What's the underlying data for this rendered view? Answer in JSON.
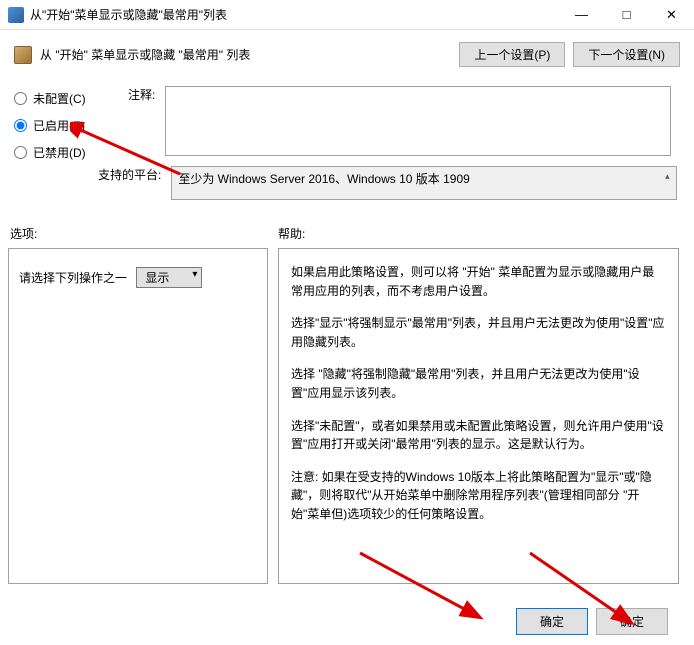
{
  "window": {
    "title": "从\"开始\"菜单显示或隐藏\"最常用\"列表"
  },
  "header": {
    "title": "从 \"开始\" 菜单显示或隐藏 \"最常用\" 列表",
    "prev_btn": "上一个设置(P)",
    "next_btn": "下一个设置(N)"
  },
  "radios": {
    "not_configured": "未配置(C)",
    "enabled": "已启用(E)",
    "disabled": "已禁用(D)"
  },
  "comment": {
    "label": "注释:",
    "value": ""
  },
  "platform": {
    "label": "支持的平台:",
    "value": "至少为 Windows Server 2016、Windows 10 版本 1909"
  },
  "captions": {
    "options": "选项:",
    "help": "帮助:"
  },
  "options": {
    "prompt": "请选择下列操作之一",
    "dropdown_value": "显示"
  },
  "help": {
    "p1": "如果启用此策略设置，则可以将 \"开始\" 菜单配置为显示或隐藏用户最常用应用的列表，而不考虑用户设置。",
    "p2": "选择\"显示\"将强制显示\"最常用\"列表，并且用户无法更改为使用\"设置\"应用隐藏列表。",
    "p3": "选择 \"隐藏\"将强制隐藏\"最常用\"列表，并且用户无法更改为使用\"设置\"应用显示该列表。",
    "p4": "选择\"未配置\"，或者如果禁用或未配置此策略设置，则允许用户使用\"设置\"应用打开或关闭\"最常用\"列表的显示。这是默认行为。",
    "p5": "注意:   如果在受支持的Windows 10版本上将此策略配置为\"显示\"或\"隐藏\"，则将取代\"从开始菜单中删除常用程序列表\"(管理相同部分  \"开始\"菜单但)选项较少的任何策略设置。"
  },
  "buttons": {
    "ok1": "确定",
    "ok2": "确定"
  }
}
